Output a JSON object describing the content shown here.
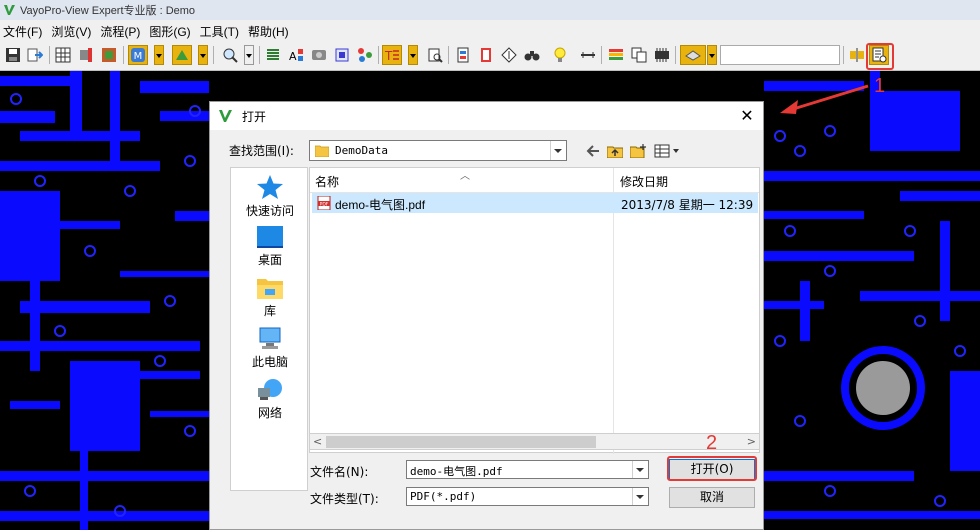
{
  "window": {
    "title": "VayoPro-View Expert专业版 : Demo"
  },
  "menu": {
    "items": [
      "文件(F)",
      "浏览(V)",
      "流程(P)",
      "图形(G)",
      "工具(T)",
      "帮助(H)"
    ]
  },
  "toolbar": {
    "search_value": ""
  },
  "annotations": {
    "step1": "1",
    "step2": "2",
    "color": "#e53935"
  },
  "dialog": {
    "title": "打开",
    "close_glyph": "✕",
    "look_in_label": "查找范围(I):",
    "look_in_value": "DemoData",
    "places": [
      {
        "label": "快速访问",
        "icon": "star-icon"
      },
      {
        "label": "桌面",
        "icon": "desktop-icon"
      },
      {
        "label": "库",
        "icon": "library-icon"
      },
      {
        "label": "此电脑",
        "icon": "computer-icon"
      },
      {
        "label": "网络",
        "icon": "network-icon"
      }
    ],
    "columns": {
      "name": "名称",
      "modified": "修改日期"
    },
    "files": [
      {
        "name": "demo-电气图.pdf",
        "modified": "2013/7/8 星期一 12:39",
        "icon": "pdf-icon",
        "selected": true
      }
    ],
    "file_name_label": "文件名(N):",
    "file_name_value": "demo-电气图.pdf",
    "file_type_label": "文件类型(T):",
    "file_type_value": "PDF(*.pdf)",
    "open_button": "打开(O)",
    "cancel_button": "取消"
  }
}
